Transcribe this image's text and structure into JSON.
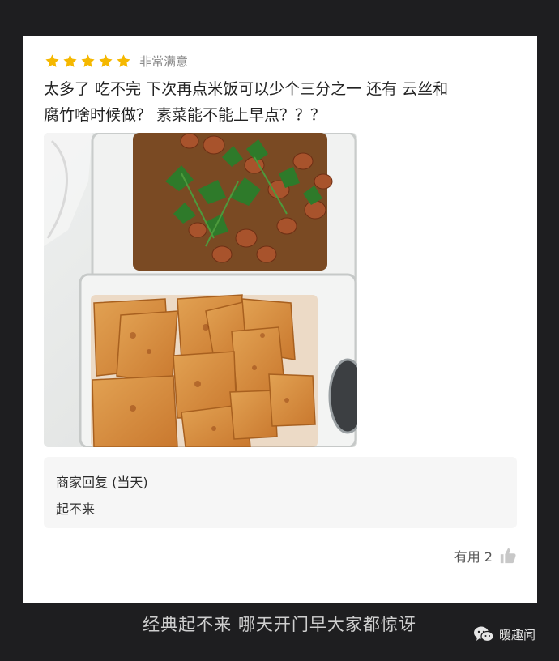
{
  "review": {
    "rating_stars": 5,
    "rating_label": "非常满意",
    "text_line1": "太多了 吃不完 下次再点米饭可以少个三分之一 还有 云丝和",
    "text_line2": "腐竹啥时候做？ 素菜能不能上早点？？？",
    "photo_icon": "food-photo"
  },
  "reply": {
    "title": "商家回复 (当天)",
    "text": "起不来"
  },
  "helpful": {
    "label": "有用 2",
    "icon": "thumbs-up-icon"
  },
  "caption": "经典起不来 哪天开门早大家都惊讶",
  "brand": {
    "name": "暖趣闻",
    "icon": "wechat-icon"
  },
  "colors": {
    "star": "#f5b800",
    "background": "#1e1e20",
    "card": "#ffffff",
    "reply_bg": "#f6f6f6"
  }
}
